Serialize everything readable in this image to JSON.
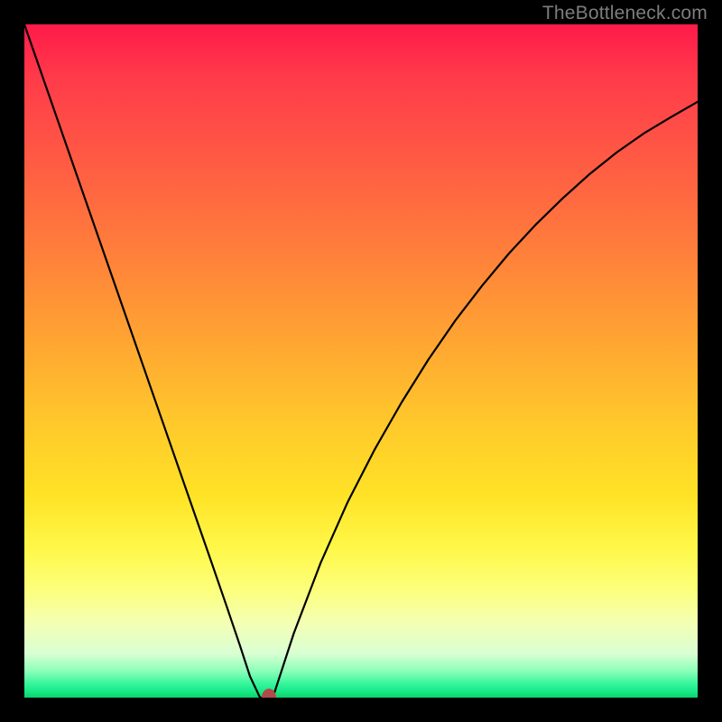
{
  "watermark": "TheBottleneck.com",
  "chart_data": {
    "type": "line",
    "title": "",
    "xlabel": "",
    "ylabel": "",
    "xlim": [
      0,
      100
    ],
    "ylim": [
      0,
      100
    ],
    "background_gradient": [
      "#ff1a4a",
      "#ff7a3c",
      "#ffe326",
      "#16e785"
    ],
    "series": [
      {
        "name": "bottleneck-curve",
        "x": [
          0,
          4,
          8,
          12,
          16,
          20,
          24,
          28,
          30,
          32,
          33.5,
          35,
          36,
          37,
          40,
          44,
          48,
          52,
          56,
          60,
          64,
          68,
          72,
          76,
          80,
          84,
          88,
          92,
          96,
          100
        ],
        "y": [
          100,
          88.5,
          77,
          65.5,
          54,
          42.5,
          31,
          19.5,
          13.7,
          7.8,
          3.2,
          0,
          0,
          0.3,
          9.5,
          20,
          29,
          36.8,
          43.8,
          50.2,
          56,
          61.2,
          66,
          70.3,
          74.2,
          77.8,
          81,
          83.8,
          86.2,
          88.5
        ]
      }
    ],
    "marker": {
      "x": 36.3,
      "y": 0
    }
  }
}
